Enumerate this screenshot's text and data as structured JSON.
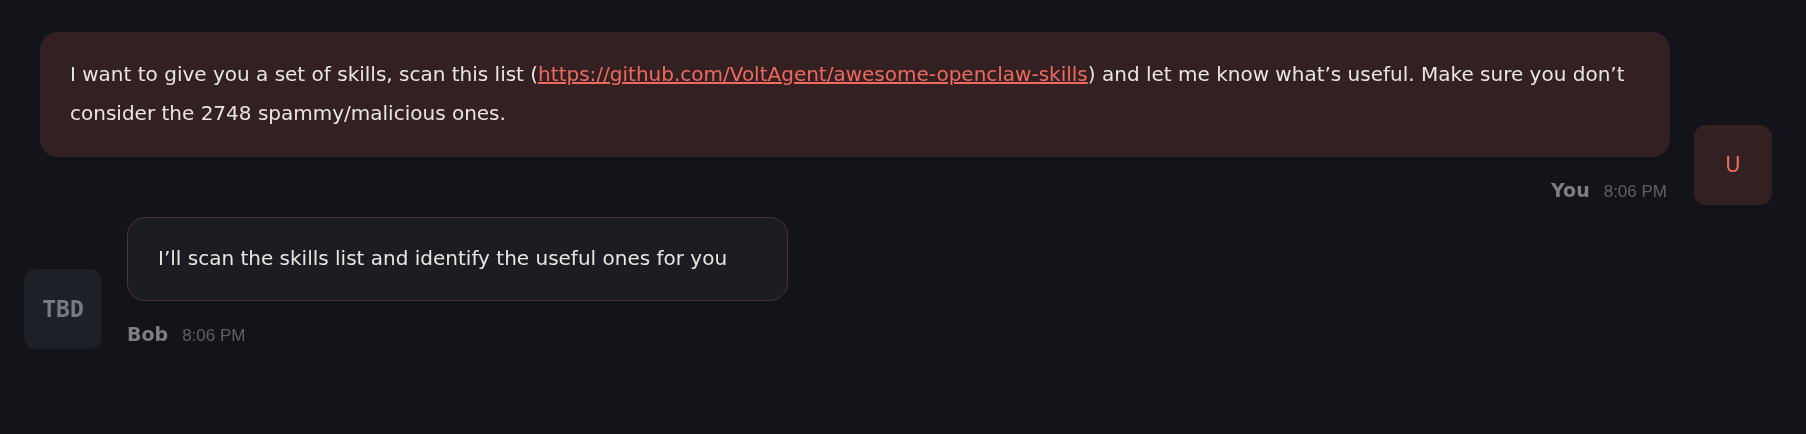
{
  "messages": [
    {
      "kind": "user",
      "text_before": "I want to give you a set of skills, scan this list (",
      "link": "https://github.com/VoltAgent/awesome-openclaw-skills",
      "text_after": ") and let me know what’s useful. Make sure you don’t consider the 2748 spammy/malicious ones.",
      "sender": "You",
      "time": "8:06 PM",
      "avatar": "U"
    },
    {
      "kind": "assistant",
      "text_before": "I’ll scan the skills list and identify the useful ones for you",
      "sender": "Bob",
      "time": "8:06 PM",
      "avatar": "TBD"
    }
  ]
}
